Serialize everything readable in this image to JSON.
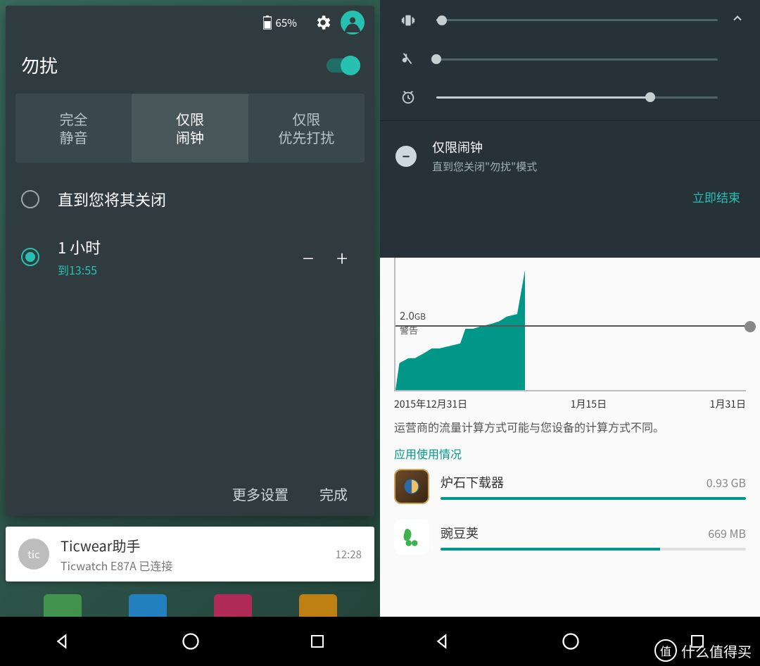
{
  "left": {
    "battery_pct": "65%",
    "dnd_title": "勿扰",
    "segments": [
      "完全\n静音",
      "仅限\n闹钟",
      "仅限\n优先打扰"
    ],
    "active_segment": 1,
    "opt_forever": "直到您将其关闭",
    "opt_hour_title": "1 小时",
    "opt_hour_sub": "到13:55",
    "more_settings": "更多设置",
    "done": "完成",
    "notif_title": "Ticwear助手",
    "notif_sub": "Ticwatch E87A 已连接",
    "notif_time": "12:28",
    "notif_icon_text": "tic"
  },
  "right": {
    "dnd_mode_title": "仅限闹钟",
    "dnd_mode_sub": "直到您关闭\"勿扰\"模式",
    "end_now": "立即结束",
    "sliders": {
      "ring": 2,
      "media": 0,
      "alarm": 76
    },
    "warn_value": "2.0",
    "warn_unit": "GB",
    "warn_word": "警告",
    "axis": [
      "2015年12月31日",
      "1月15日",
      "1月31日"
    ],
    "disclaimer": "运营商的流量计算方式可能与您设备的计算方式不同。",
    "section": "应用使用情况",
    "apps": [
      {
        "name": "炉石下载器",
        "size": "0.93 GB",
        "pct": 100,
        "color": "#b37a3c"
      },
      {
        "name": "豌豆荚",
        "size": "669 MB",
        "pct": 72,
        "color": "#3fb24f"
      }
    ]
  },
  "watermark": "什么值得买",
  "watermark_badge": "值",
  "chart_data": {
    "type": "area",
    "title": "",
    "xlabel": "",
    "ylabel": "",
    "x_range_labels": [
      "2015年12月31日",
      "1月15日",
      "1月31日"
    ],
    "warning_level_gb": 2.0,
    "series": [
      {
        "name": "cumulative_data_gb",
        "x_days_from_start": [
          0,
          1,
          2,
          3,
          4,
          5,
          6,
          7,
          8,
          9,
          10,
          11,
          12,
          13
        ],
        "values": [
          0.15,
          0.35,
          0.45,
          0.5,
          0.6,
          0.7,
          0.75,
          0.8,
          1.05,
          1.1,
          1.15,
          1.2,
          1.3,
          2.1
        ]
      }
    ],
    "ylim": [
      0,
      2.2
    ]
  }
}
